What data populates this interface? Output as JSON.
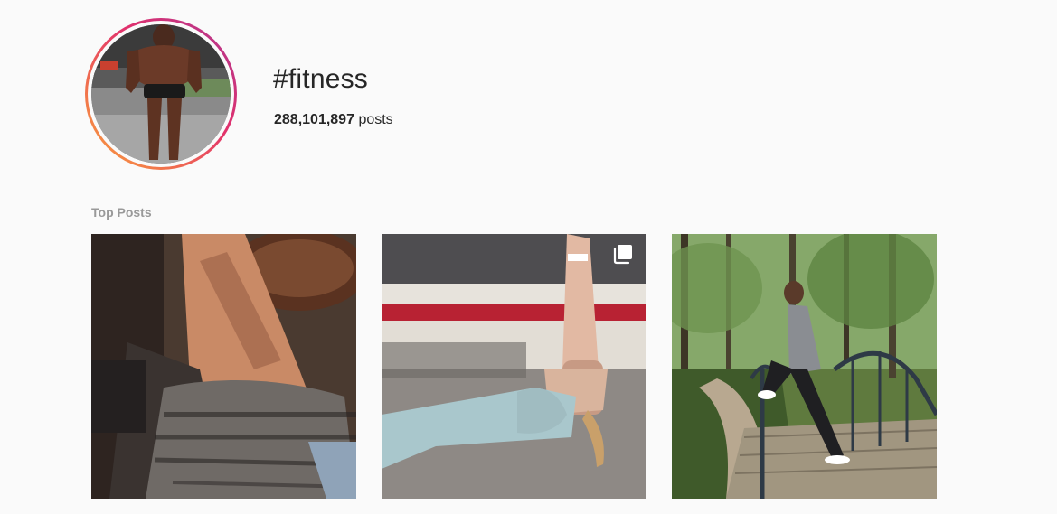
{
  "header": {
    "hashtag": "#fitness",
    "post_count": "288,101,897",
    "post_count_suffix": "posts"
  },
  "sections": {
    "top_posts_label": "Top Posts"
  },
  "posts": [
    {
      "kind": "single-photo",
      "icon": null
    },
    {
      "kind": "carousel",
      "icon": "multiple-photos-icon"
    },
    {
      "kind": "single-photo",
      "icon": null
    }
  ],
  "colors": {
    "background": "#fafafa",
    "text": "#262626",
    "muted": "#999999"
  }
}
